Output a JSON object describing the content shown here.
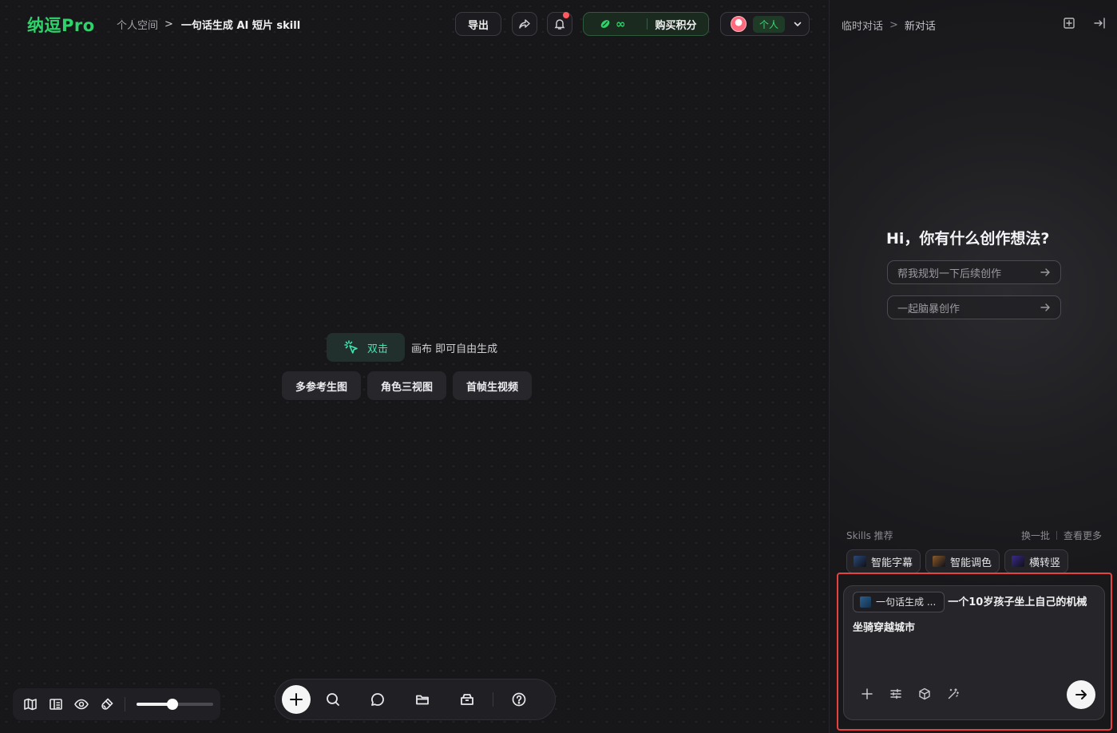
{
  "brand": {
    "logo": "纳逗Pro"
  },
  "breadcrumb": {
    "space": "个人空间",
    "separator": ">",
    "project": "一句话生成 AI 短片 skill"
  },
  "header": {
    "export_label": "导出",
    "credits_symbol": "∞",
    "buy_credits_label": "购买积分",
    "account_label": "个人"
  },
  "canvas": {
    "hint_action": "双击",
    "hint_text": "画布 即可自由生成",
    "quick_actions": [
      "多参考生图",
      "角色三视图",
      "首帧生视频"
    ]
  },
  "bottom_toolbar": {
    "zoom_fraction": 0.47
  },
  "panel": {
    "breadcrumb_root": "临时对话",
    "breadcrumb_separator": ">",
    "breadcrumb_current": "新对话",
    "greeting": "Hi，你有什么创作想法?",
    "suggestions": [
      "帮我规划一下后续创作",
      "一起脑暴创作"
    ],
    "skills_title": "Skills 推荐",
    "skills_refresh": "换一批",
    "skills_more": "查看更多",
    "skills": [
      {
        "label": "智能字幕",
        "color": "#2a4a7a"
      },
      {
        "label": "智能调色",
        "color": "#8a5a2a"
      },
      {
        "label": "横转竖",
        "color": "#3a2a8a"
      }
    ],
    "input": {
      "skill_tag": "一句话生成 ...",
      "text": "一个10岁孩子坐上自己的机械坐骑穿越城市"
    }
  },
  "colors": {
    "brand_green": "#2fd36b",
    "highlight_red": "#e84142",
    "notification": "#ff5a5f"
  }
}
